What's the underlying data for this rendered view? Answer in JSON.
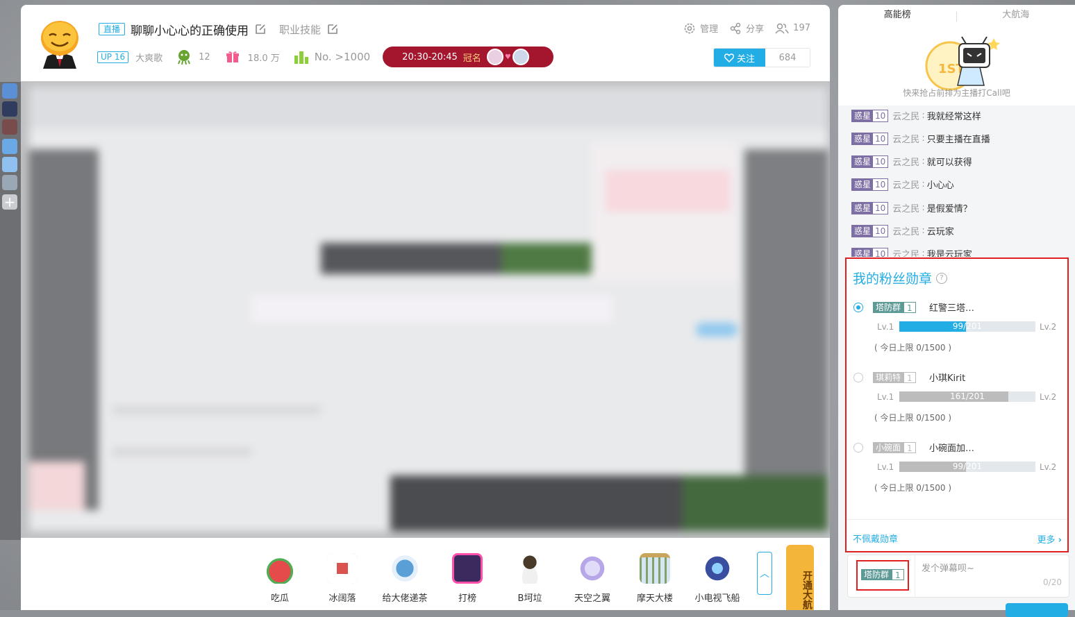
{
  "header": {
    "live_tag": "直播",
    "room_title": "聊聊小心心的正确使用",
    "area": "职业技能",
    "up_level": "UP 16",
    "streamer_name": "大爽歌",
    "guard_count": "12",
    "gift_value": "18.0 万",
    "rank": "No. >1000",
    "rank_banner_time": "20:30-20:45",
    "rank_banner_label": "冠名",
    "manage_label": "管理",
    "share_label": "分享",
    "viewer_count": "197",
    "follow_label": "关注",
    "follower_count": "684"
  },
  "gifts": [
    {
      "label": "吃瓜",
      "color": "#e54b4b"
    },
    {
      "label": "冰阔落",
      "color": "#d9534f"
    },
    {
      "label": "给大佬递茶",
      "color": "#5aa0d6"
    },
    {
      "label": "打榜",
      "color": "#c33fa6"
    },
    {
      "label": "B坷垃",
      "color": "#4a3a2a"
    },
    {
      "label": "天空之翼",
      "color": "#b7a7e8"
    },
    {
      "label": "摩天大楼",
      "color": "#7fa36a"
    },
    {
      "label": "小电视飞船",
      "color": "#3a4e9f"
    }
  ],
  "vip_open_label": "开通大航",
  "right_panel": {
    "tabs": [
      "高能榜",
      "大航海"
    ],
    "rank_empty_text": "快来抢占前排为主播打Call吧",
    "rank_badge": "1ST",
    "chat": [
      {
        "medal": "惑星",
        "level": "10",
        "user": "云之民",
        "text": "我就经常这样"
      },
      {
        "medal": "惑星",
        "level": "10",
        "user": "云之民",
        "text": "只要主播在直播"
      },
      {
        "medal": "惑星",
        "level": "10",
        "user": "云之民",
        "text": "就可以获得"
      },
      {
        "medal": "惑星",
        "level": "10",
        "user": "云之民",
        "text": "小心心"
      },
      {
        "medal": "惑星",
        "level": "10",
        "user": "云之民",
        "text": "是假爱情？"
      },
      {
        "medal": "惑星",
        "level": "10",
        "user": "云之民",
        "text": "云玩家"
      },
      {
        "medal": "惑星",
        "level": "10",
        "user": "云之民",
        "text": "我是云玩家"
      }
    ],
    "fan_medal_popup": {
      "title": "我的粉丝勋章",
      "help": "?",
      "items": [
        {
          "medal": "塔防群",
          "level": "1",
          "name": "红警三塔…",
          "lv_from": "Lv.1",
          "lv_to": "Lv.2",
          "progress": "99/201",
          "fraction": 0.49,
          "limit": "( 今日上限 0/1500 )",
          "selected": true,
          "color": "#5d9a95",
          "bar_color": "#23ade5"
        },
        {
          "medal": "琪莉特",
          "level": "1",
          "name": "小琪Kirit",
          "lv_from": "Lv.1",
          "lv_to": "Lv.2",
          "progress": "161/201",
          "fraction": 0.8,
          "limit": "( 今日上限 0/1500 )",
          "selected": false,
          "color": "#bcbcbc",
          "bar_color": "#bcbcbc"
        },
        {
          "medal": "小碗面",
          "level": "1",
          "name": "小碗面加…",
          "lv_from": "Lv.1",
          "lv_to": "Lv.2",
          "progress": "99/201",
          "fraction": 0.49,
          "limit": "( 今日上限 0/1500 )",
          "selected": false,
          "color": "#bcbcbc",
          "bar_color": "#bcbcbc"
        }
      ],
      "no_wear_label": "不佩戴勋章",
      "more_label": "更多"
    },
    "input": {
      "medal": "塔防群",
      "level": "1",
      "placeholder": "发个弹幕呗~",
      "counter": "0/20"
    }
  },
  "colors": {
    "accent": "#23ade5",
    "rank_banner": "#a3162d",
    "highlight": "#e02020",
    "medal_purple": "#7d6fa3"
  }
}
